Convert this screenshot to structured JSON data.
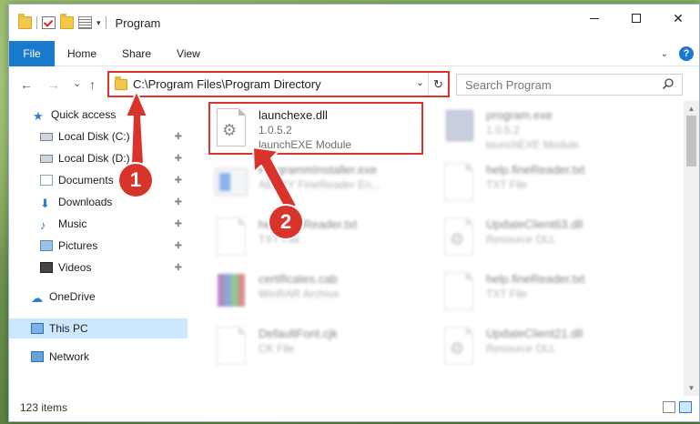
{
  "window": {
    "title": "Program",
    "qat_dropdown": "▾",
    "minimize": "—",
    "maximize": "☐",
    "close": "✕"
  },
  "ribbon": {
    "file_tab": "File",
    "tabs": [
      "Home",
      "Share",
      "View"
    ],
    "collapse": "⌄",
    "help": "?"
  },
  "address": {
    "path": "C:\\Program Files\\Program Directory",
    "dropdown": "⌄",
    "refresh": "↻",
    "back": "←",
    "forward": "→",
    "recent": "⌄",
    "up": "↑"
  },
  "search": {
    "placeholder": "Search Program"
  },
  "nav": {
    "items": [
      {
        "label": "Quick access",
        "icon": "star-icon"
      },
      {
        "label": "Local Disk (C:)",
        "icon": "disk-icon",
        "pinned": true
      },
      {
        "label": "Local Disk (D:)",
        "icon": "disk-icon",
        "pinned": true
      },
      {
        "label": "Documents",
        "icon": "documents-icon",
        "pinned": true
      },
      {
        "label": "Downloads",
        "icon": "downloads-icon",
        "pinned": true
      },
      {
        "label": "Music",
        "icon": "music-icon",
        "pinned": true
      },
      {
        "label": "Pictures",
        "icon": "pictures-icon",
        "pinned": true
      },
      {
        "label": "Videos",
        "icon": "videos-icon",
        "pinned": true
      },
      {
        "label": "OneDrive",
        "icon": "onedrive-icon"
      },
      {
        "label": "This PC",
        "icon": "computer-icon",
        "selected": true
      },
      {
        "label": "Network",
        "icon": "network-icon"
      }
    ],
    "pin_glyph": "📌"
  },
  "files": [
    {
      "name": "launchexe.dll",
      "line2": "1.0.5.2",
      "line3": "launchEXE Module",
      "icon": "dll-gear-icon",
      "highlighted": true
    },
    {
      "name": "program.exe",
      "line2": "1.0.5.2",
      "line3": "launchEXE Module",
      "icon": "exe-icon"
    },
    {
      "name": "ProgrammInstaller.exe",
      "line2": "ABBYY FineReader En...",
      "line3": "",
      "icon": "installer-icon"
    },
    {
      "name": "help.fineReader.txt",
      "line2": "TXT File",
      "line3": "",
      "icon": "text-file-icon"
    },
    {
      "name": "help.fineReader.txt",
      "line2": "TXT File",
      "line3": "",
      "icon": "text-file-icon"
    },
    {
      "name": "UpdateClient63.dll",
      "line2": "Resource DLL",
      "line3": "",
      "icon": "dll-gear-icon"
    },
    {
      "name": "certificates.cab",
      "line2": "WinRAR Archive",
      "line3": "",
      "icon": "archive-icon"
    },
    {
      "name": "help.fineReader.txt",
      "line2": "TXT File",
      "line3": "",
      "icon": "text-file-icon"
    },
    {
      "name": "DefaultFont.cjk",
      "line2": "CK File",
      "line3": "",
      "icon": "text-file-icon"
    },
    {
      "name": "UpdateClient21.dll",
      "line2": "Resource DLL",
      "line3": "",
      "icon": "dll-gear-icon"
    }
  ],
  "status": {
    "count": "123 items"
  },
  "annotations": {
    "step1": "1",
    "step2": "2",
    "color": "#d9342b"
  }
}
